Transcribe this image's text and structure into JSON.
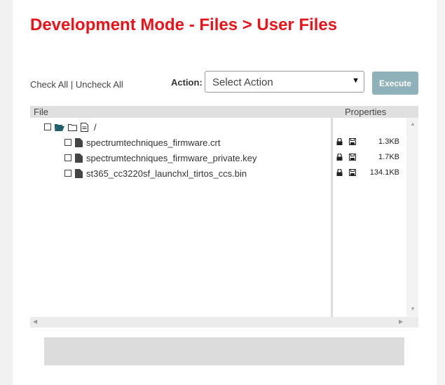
{
  "header": {
    "title": "Development Mode - Files > User Files"
  },
  "toolbar": {
    "check_all": "Check All",
    "separator": "|",
    "uncheck_all": "Uncheck All",
    "action_label": "Action:",
    "action_selected": "Select Action",
    "execute_label": "Execute"
  },
  "table": {
    "col_file": "File",
    "col_properties": "Properties",
    "root": {
      "label": "/"
    },
    "files": [
      {
        "name": "spectrumtechniques_firmware.crt",
        "size": "1.3KB"
      },
      {
        "name": "spectrumtechniques_firmware_private.key",
        "size": "1.7KB"
      },
      {
        "name": "st365_cc3220sf_launchxl_tirtos_ccs.bin",
        "size": "134.1KB"
      }
    ]
  },
  "colors": {
    "title": "#e8141c",
    "execute_bg": "#8fb1b9"
  },
  "icons": [
    "folder-open-icon",
    "folder-icon",
    "document-icon",
    "file-icon",
    "lock-icon",
    "save-icon"
  ]
}
